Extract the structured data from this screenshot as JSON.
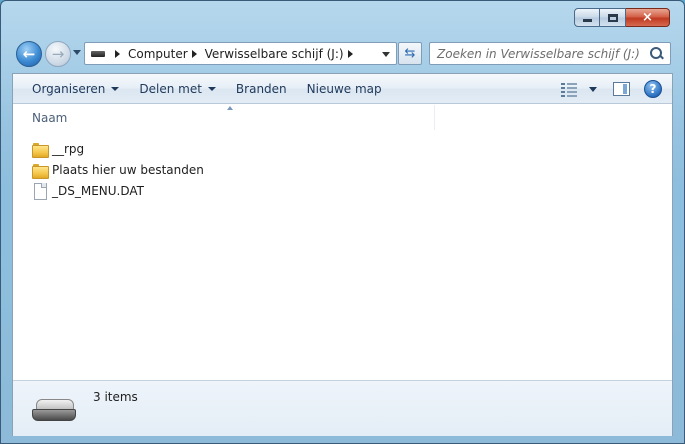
{
  "window": {
    "caption_buttons": {
      "minimize": "minimize-icon",
      "maximize": "maximize-icon",
      "close": "×"
    }
  },
  "nav": {
    "back_glyph": "←",
    "forward_glyph": "→",
    "breadcrumbs": [
      "Computer",
      "Verwisselbare schijf (J:)"
    ],
    "refresh_glyph": "⇆",
    "search_placeholder": "Zoeken in Verwisselbare schijf (J:)"
  },
  "toolbar": {
    "organize": "Organiseren",
    "share": "Delen met",
    "burn": "Branden",
    "new_folder": "Nieuwe map",
    "help_glyph": "?"
  },
  "columns": {
    "name": "Naam"
  },
  "files": [
    {
      "name": "__rpg",
      "type": "folder",
      "icon": "folder-icon"
    },
    {
      "name": "Plaats hier uw bestanden",
      "type": "folder",
      "icon": "folder-icon"
    },
    {
      "name": "_DS_MENU.DAT",
      "type": "file",
      "icon": "file-icon"
    }
  ],
  "details": {
    "item_count": "3 items",
    "icon": "removable-drive-icon"
  },
  "colors": {
    "toolbar_text": "#1e395b",
    "close_button": "#c03a20",
    "accent": "#2a6fc0"
  }
}
